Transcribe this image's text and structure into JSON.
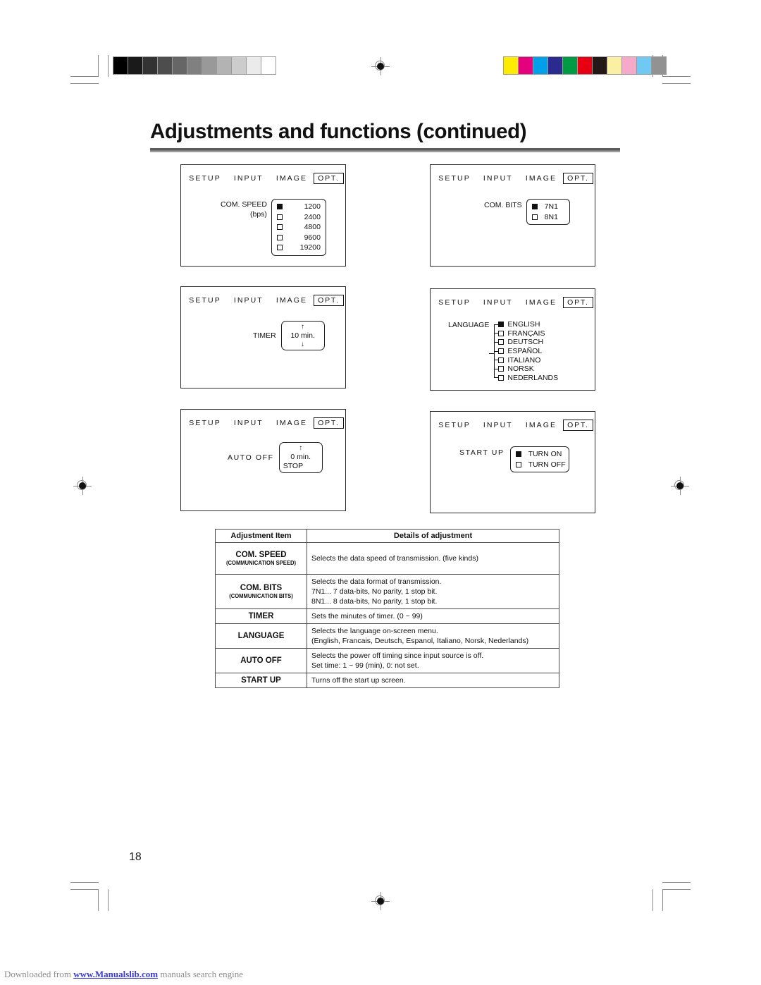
{
  "document": {
    "title": "Adjustments and functions (continued)",
    "page_number": "18"
  },
  "footer": {
    "prefix": "Downloaded from ",
    "link": "www.Manualslib.com",
    "suffix": " manuals search engine"
  },
  "osd_menu": {
    "tabs": [
      "SETUP",
      "INPUT",
      "IMAGE"
    ],
    "selected_tab": "OPT."
  },
  "panels": [
    {
      "name": "com-speed",
      "label": "COM. SPEED",
      "sublabel": "(bps)",
      "options": [
        {
          "value": "1200",
          "checked": true
        },
        {
          "value": "2400",
          "checked": false
        },
        {
          "value": "4800",
          "checked": false
        },
        {
          "value": "9600",
          "checked": false
        },
        {
          "value": "19200",
          "checked": false
        }
      ]
    },
    {
      "name": "com-bits",
      "label": "COM. BITS",
      "options": [
        {
          "value": "7N1",
          "checked": true
        },
        {
          "value": "8N1",
          "checked": false
        }
      ]
    },
    {
      "name": "timer",
      "label": "TIMER",
      "up_arrow": "↑",
      "down_arrow": "↓",
      "value": "10  min."
    },
    {
      "name": "language",
      "label": "LANGUAGE",
      "options": [
        {
          "value": "ENGLISH",
          "checked": true
        },
        {
          "value": "FRANÇAIS",
          "checked": false
        },
        {
          "value": "DEUTSCH",
          "checked": false
        },
        {
          "value": "ESPAÑOL",
          "checked": false
        },
        {
          "value": "ITALIANO",
          "checked": false
        },
        {
          "value": "NORSK",
          "checked": false
        },
        {
          "value": "NEDERLANDS",
          "checked": false
        }
      ]
    },
    {
      "name": "auto-off",
      "label": "AUTO OFF",
      "up_arrow": "↑",
      "value": "0  min.",
      "stop_label": "STOP"
    },
    {
      "name": "start-up",
      "label": "START UP",
      "options": [
        {
          "value": "TURN ON",
          "checked": true
        },
        {
          "value": "TURN OFF",
          "checked": false
        }
      ]
    }
  ],
  "table": {
    "headers": [
      "Adjustment Item",
      "Details of adjustment"
    ],
    "rows": [
      {
        "item": "COM. SPEED",
        "item_sub": "(COMMUNICATION SPEED)",
        "details": [
          "Selects the data speed of transmission. (five kinds)"
        ]
      },
      {
        "item": "COM. BITS",
        "item_sub": "(COMMUNICATION BITS)",
        "details": [
          "Selects the data format of transmission.",
          "7N1... 7 data-bits, No parity, 1 stop bit.",
          "8N1... 8 data-bits, No parity, 1 stop bit."
        ]
      },
      {
        "item": "TIMER",
        "item_sub": "",
        "details": [
          "Sets the minutes of timer. (0 ~ 99)"
        ]
      },
      {
        "item": "LANGUAGE",
        "item_sub": "",
        "details": [
          "Selects the language on-screen menu.",
          "(English, Francais, Deutsch, Espanol, Italiano, Norsk, Nederlands)"
        ]
      },
      {
        "item": "AUTO OFF",
        "item_sub": "",
        "details": [
          "Selects the power off timing since input source is off.",
          "Set time: 1 ~ 99 (min), 0: not set."
        ]
      },
      {
        "item": "START UP",
        "item_sub": "",
        "details": [
          "Turns off the start up screen."
        ]
      }
    ]
  },
  "print_marks": {
    "grey_bar": [
      "#000000",
      "#1a1a1a",
      "#333333",
      "#4d4d4d",
      "#666666",
      "#808080",
      "#999999",
      "#b3b3b3",
      "#cccccc",
      "#ebebeb",
      "#ffffff"
    ],
    "color_bar": [
      "#fdec00",
      "#e5007e",
      "#00a0e9",
      "#2b2b8f",
      "#009944",
      "#e60012",
      "#231815",
      "#fbefa4",
      "#f4aac8",
      "#6fc9f2",
      "#929292"
    ]
  }
}
